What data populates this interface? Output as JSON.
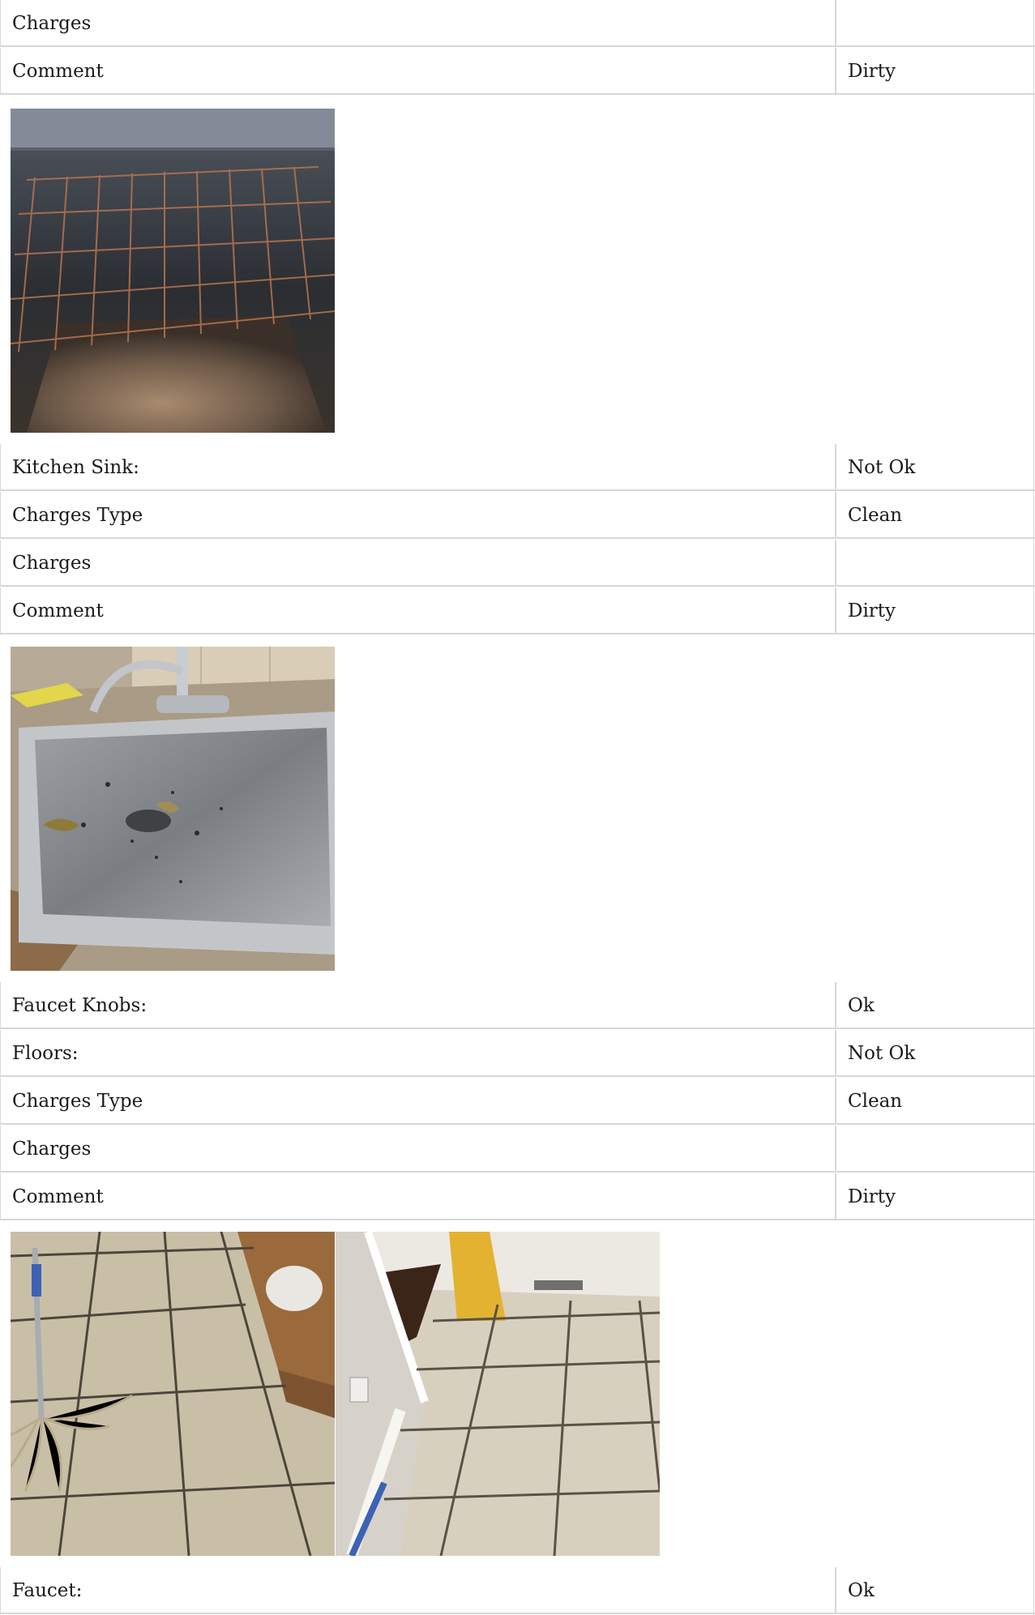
{
  "rows": [
    {
      "label": "Charges",
      "value": ""
    },
    {
      "label": "Comment",
      "value": "Dirty"
    },
    {
      "label": "Kitchen Sink:",
      "value": "Not Ok"
    },
    {
      "label": "Charges Type",
      "value": "Clean"
    },
    {
      "label": "Charges",
      "value": ""
    },
    {
      "label": "Comment",
      "value": "Dirty"
    },
    {
      "label": "Faucet Knobs:",
      "value": "Ok"
    },
    {
      "label": "Floors:",
      "value": "Not Ok"
    },
    {
      "label": "Charges Type",
      "value": "Clean"
    },
    {
      "label": "Charges",
      "value": ""
    },
    {
      "label": "Comment",
      "value": "Dirty"
    },
    {
      "label": "Faucet:",
      "value": "Ok"
    }
  ]
}
